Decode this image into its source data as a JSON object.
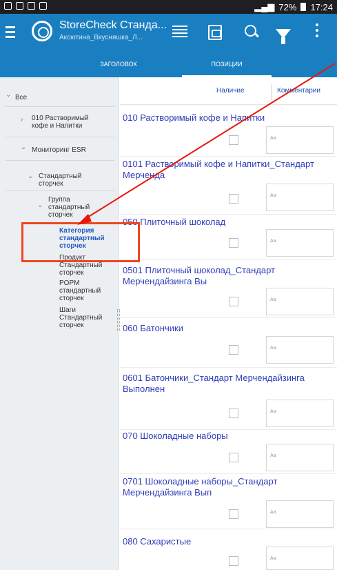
{
  "status_bar": {
    "battery": "72%",
    "time": "17:24"
  },
  "app": {
    "title": "StoreCheck Станда...",
    "subtitle": "Аксютина_Вкусняшка_Л..."
  },
  "tabs": [
    {
      "label": "ЗАГОЛОВОК",
      "active": false
    },
    {
      "label": "ПОЗИЦИИ",
      "active": true
    }
  ],
  "sidebar": {
    "items": [
      {
        "label": "Все",
        "chevron": "down"
      },
      {
        "label": "010 Растворимый кофе и Напитки",
        "chevron": "right"
      },
      {
        "label": "Мониторинг ESR",
        "chevron": "down"
      },
      {
        "label": "Стандартный сторчек",
        "chevron": "down"
      },
      {
        "label": "Группа стандартный сторчек",
        "chevron": "down"
      },
      {
        "label": "Категория стандартный сторчек",
        "chevron": "",
        "active": true
      },
      {
        "label": "Продукт Стандартный сторчек",
        "chevron": ""
      },
      {
        "label": "POPM стандартный сторчек",
        "chevron": ""
      },
      {
        "label": "Шаги Стандартный сторчек",
        "chevron": ""
      }
    ]
  },
  "columns": {
    "presence": "Наличие",
    "comments": "Комментарии"
  },
  "rows": [
    {
      "title": "010 Растворимый кофе и Напитки",
      "comment_placeholder": "Аа"
    },
    {
      "title": "0101 Растворимый кофе и Напитки_Стандарт Мерченда",
      "comment_placeholder": "Аа"
    },
    {
      "title": "050 Плиточный шоколад",
      "comment_placeholder": "Аа"
    },
    {
      "title": "0501 Плиточный шоколад_Стандарт Мерчендайзинга Вы",
      "comment_placeholder": "Аа"
    },
    {
      "title": "060 Батончики",
      "comment_placeholder": "Аа"
    },
    {
      "title": "0601 Батончики_Стандарт Мерчендайзинга Выполнен",
      "comment_placeholder": "Аа"
    },
    {
      "title": "070 Шоколадные наборы",
      "comment_placeholder": "Аа"
    },
    {
      "title": "0701 Шоколадные наборы_Стандарт Мерчендайзинга Вып",
      "comment_placeholder": "Аа"
    },
    {
      "title": "080 Сахаристые",
      "comment_placeholder": "Аа"
    }
  ],
  "colors": {
    "app_bar": "#1a7fc1",
    "status_bar": "#1d1f22",
    "row_title": "#2f3eb7",
    "active_nav": "#2259c4",
    "annotation": "#f0451f"
  }
}
